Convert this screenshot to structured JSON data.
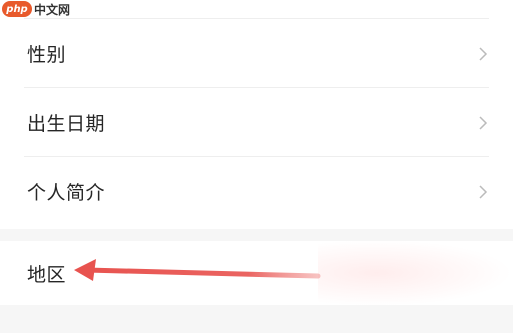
{
  "watermark": {
    "logo": "php",
    "text": "中文网"
  },
  "settings": {
    "items": [
      {
        "label": "性别"
      },
      {
        "label": "出生日期"
      },
      {
        "label": "个人简介"
      }
    ],
    "region": {
      "label": "地区"
    }
  },
  "colors": {
    "arrow": "#e8534f",
    "divider": "#eeeeee",
    "section_bg": "#f6f6f6",
    "chevron": "#bbbbbb",
    "watermark_logo": "#e85a2c"
  }
}
